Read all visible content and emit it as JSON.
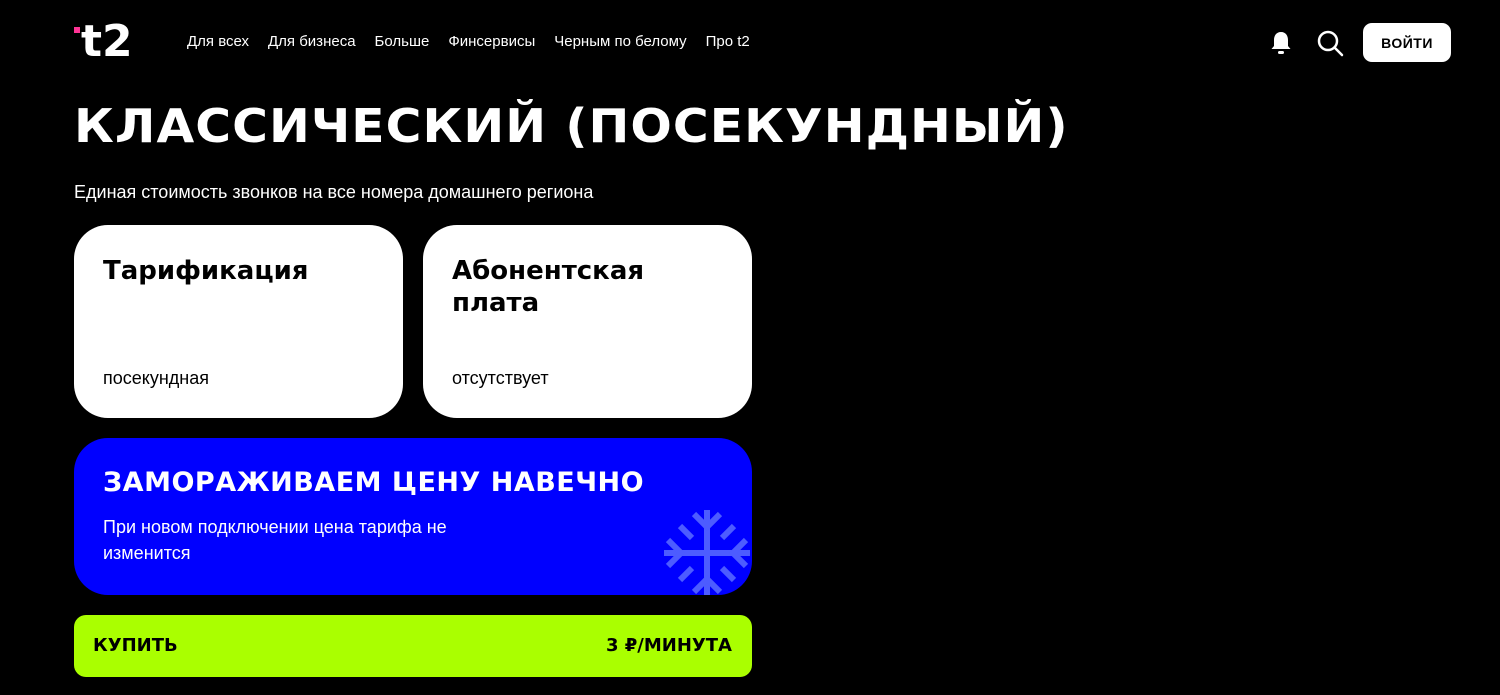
{
  "header": {
    "logo_text": "t2",
    "nav": [
      {
        "label": "Для всех"
      },
      {
        "label": "Для бизнеса"
      },
      {
        "label": "Больше"
      },
      {
        "label": "Финсервисы"
      },
      {
        "label": "Черным по белому"
      },
      {
        "label": "Про t2"
      }
    ],
    "login_label": "ВОЙТИ",
    "icons": [
      "bell-icon",
      "search-icon"
    ]
  },
  "main": {
    "title": "КЛАССИЧЕСКИЙ (ПОСЕКУНДНЫЙ)",
    "subtitle": "Единая стоимость звонков на все номера домашнего региона",
    "cards": [
      {
        "title": "Тарификация",
        "value": "посекундная"
      },
      {
        "title": "Абонентская плата",
        "value": "отсутствует"
      }
    ],
    "promo": {
      "title": "ЗАМОРАЖИВАЕМ ЦЕНУ НАВЕЧНО",
      "text": "При новом подключении цена тарифа не изменится",
      "icon": "snowflake-icon"
    },
    "buy": {
      "label": "КУПИТЬ",
      "price": "3 ₽/МИНУТА"
    }
  },
  "colors": {
    "background": "#000000",
    "accent_pink": "#ff3495",
    "promo_blue": "#0000ff",
    "buy_green": "#aaff00",
    "card_white": "#ffffff"
  }
}
